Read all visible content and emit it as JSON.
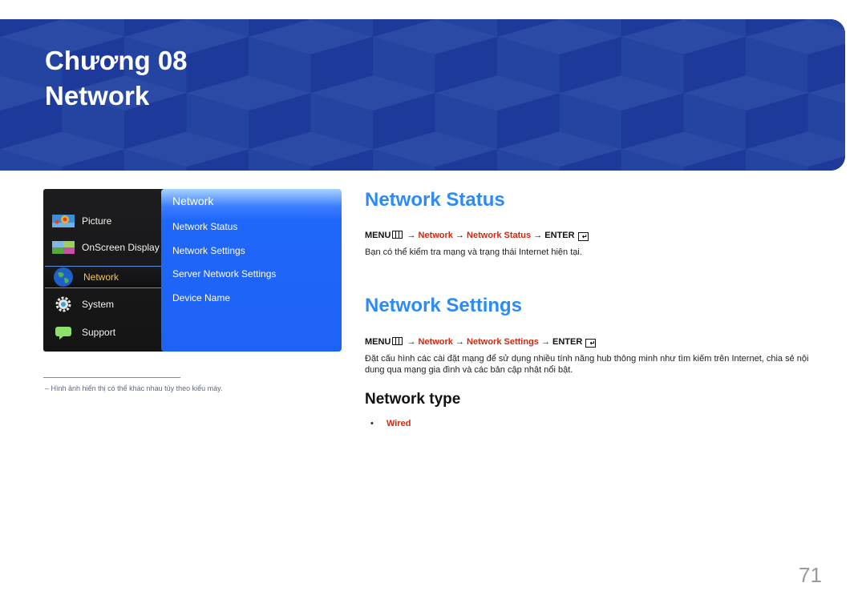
{
  "banner": {
    "chapter": "Chương 08",
    "title": "Network",
    "color": "#2341a0"
  },
  "menu_image": {
    "left_items": [
      {
        "label": "Picture",
        "icon": "picture-icon"
      },
      {
        "label": "OnScreen Display",
        "icon": "onscreen-display-icon"
      },
      {
        "label": "Network",
        "icon": "globe-icon",
        "selected": true
      },
      {
        "label": "System",
        "icon": "gear-icon"
      },
      {
        "label": "Support",
        "icon": "speech-bubble-icon"
      }
    ],
    "submenu_title": "Network",
    "submenu_items": [
      "Network Status",
      "Network Settings",
      "Server Network Settings",
      "Device Name"
    ]
  },
  "footnote": "Hình ảnh hiển thị có thể khác nhau tùy theo kiểu máy.",
  "footnote_dash": "–",
  "sections": [
    {
      "heading": "Network Status",
      "path": {
        "menu": "MENU",
        "arrow": "→",
        "step1": "Network",
        "step2": "Network Status",
        "enter": "ENTER"
      },
      "description": "Bạn có thể kiểm tra mạng và trạng thái Internet hiện tại."
    },
    {
      "heading": "Network Settings",
      "path": {
        "menu": "MENU",
        "arrow": "→",
        "step1": "Network",
        "step2": "Network Settings",
        "enter": "ENTER"
      },
      "description": "Đặt cấu hình các cài đặt mạng để sử dụng nhiều tính năng hub thông minh như tìm kiếm trên Internet, chia sẻ nội dung qua mạng gia đình và các bản cập nhật nổi bật."
    }
  ],
  "network_type": {
    "heading": "Network type",
    "bullet": "•",
    "items": [
      "Wired"
    ]
  },
  "page_number": "71",
  "colors": {
    "heading_blue": "#2e8af5",
    "path_red": "#cc2a12",
    "menu_selected": "#f4c64a"
  }
}
